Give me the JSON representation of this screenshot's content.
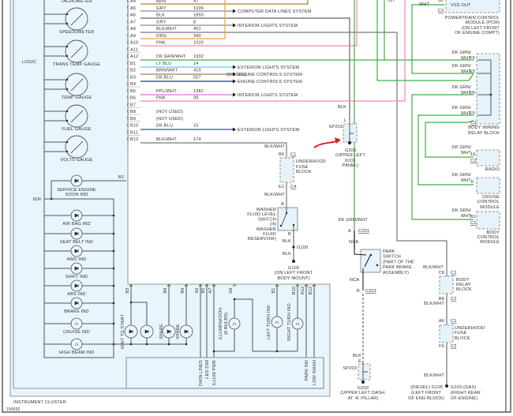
{
  "colors": {
    "cluster_fill": "#e8f5fc",
    "brn": "#a6822e",
    "org": "#f0a040",
    "gry": "#8a8a8a",
    "blk": "#555555",
    "pnk": "#f08aa8",
    "dk_grn_wht": "#3cb043",
    "lt_blu": "#3fe0e8",
    "brn_wht": "#a08050",
    "dk_blu": "#1e3090",
    "ppl_wht": "#e070e0",
    "dk_blu2": "#3a55a8",
    "annotation_red": "#e02020"
  },
  "cluster": {
    "title": "INSTRUMENT CLUSTER",
    "figure_id": "155652",
    "logic_label": "LOGIC",
    "ign_label": "IGN",
    "b2_label": "B2",
    "gauges": [
      "TACHOMETER",
      "SPEEDOMETER",
      "TRANS TEMP GAUGE",
      "TEMP GAUGE",
      "FUEL GAUGE",
      "VOLTS GAUGE"
    ],
    "service_engine": [
      "SERVICE ENGINE",
      "SOON IND"
    ],
    "indicators": [
      "AIR BAG IND",
      "SEAT BELT IND",
      "4WD IND",
      "SHIFT IND",
      "ABS IND",
      "BRAKE IND",
      "CRUISE IND",
      "HIGH BEAM IND"
    ],
    "lower_pins": [
      "B3",
      "B8",
      "B9",
      "A5",
      "B5",
      "A7",
      "A6",
      "B1",
      "B10",
      "A12",
      "B12"
    ],
    "loads": {
      "wait_to_start": "WAIT TO START",
      "spare1": "SPARE",
      "spare2": "SPARE",
      "illumination": "ILLUMINATION",
      "illumination_count": "(6 BULBS)",
      "left_turn": "LEFT TURN IND",
      "right_turn": "RIGHT TURN IND"
    },
    "box_labels": [
      "DATA LINES",
      "LED DIM",
      "ILLUM PWR",
      "PARK SW",
      "LOW WASH"
    ]
  },
  "connector_rows": [
    {
      "pin": "A4",
      "color": "BRN",
      "circuit": "47"
    },
    {
      "pin": "A5",
      "color": "GRY",
      "circuit": "1036"
    },
    {
      "pin": "A6",
      "color": "BLK",
      "circuit": "1850"
    },
    {
      "pin": "A7",
      "color": "GRY",
      "circuit": "8"
    },
    {
      "pin": "A8",
      "color": "BLK/WHT",
      "circuit": "451"
    },
    {
      "pin": "A9",
      "color": "ORG",
      "circuit": "340"
    },
    {
      "pin": "A10",
      "color": "PNK",
      "circuit": "1020"
    },
    {
      "pin": "A11",
      "color": "",
      "circuit": ""
    },
    {
      "pin": "A12",
      "color": "DK GRN/WHT",
      "circuit": "1932"
    },
    {
      "pin": "B1",
      "color": "LT BLU",
      "circuit": "14"
    },
    {
      "pin": "B2",
      "color": "BRN/WHT",
      "circuit": "419"
    },
    {
      "pin": "B3",
      "color": "DK BLU",
      "circuit": "507"
    },
    {
      "pin": "B4",
      "color": "",
      "circuit": ""
    },
    {
      "pin": "B5",
      "color": "PPL/WHT",
      "circuit": "1382"
    },
    {
      "pin": "B6",
      "color": "PNK",
      "circuit": "39"
    },
    {
      "pin": "B7",
      "color": "",
      "circuit": ""
    },
    {
      "pin": "B8",
      "color": "(NOT USED)",
      "circuit": ""
    },
    {
      "pin": "B9",
      "color": "(NOT USED)",
      "circuit": ""
    },
    {
      "pin": "B10",
      "color": "DK BLU",
      "circuit": "15"
    },
    {
      "pin": "B11",
      "color": "",
      "circuit": ""
    },
    {
      "pin": "B12",
      "color": "BLK/WHT",
      "circuit": "174"
    }
  ],
  "diesel_note": "(DIESEL)",
  "systems": {
    "a5": "COMPUTER DATA LINES SYSTEM",
    "a7": "INTERIOR LIGHTS SYSTEM",
    "b1": "EXTERIOR LIGHTS SYSTEM",
    "b2": "ENGINE CONTROLS SYSTEM",
    "b3": "ENGINE CONTROLS SYSTEM",
    "b5": "INTERIOR LIGHTS SYSTEM",
    "b10": "EXTERIOR LIGHTS SYSTEM"
  },
  "pcm": {
    "circuit": "517",
    "wire": "WHT",
    "pin": "50",
    "connector": "C2",
    "signal": "VSS OUT",
    "label": [
      "POWERTRAIN CONTROL",
      "MODULE (PCM)",
      "(ON LEFT FRONT",
      "OF ENGINE COMPT)"
    ]
  },
  "body_wiring_relay_block": {
    "wire_label": [
      "DK GRN/",
      "WHT"
    ],
    "pins": [
      "F6",
      "E5",
      "D5",
      "F5"
    ],
    "connector": "C3",
    "label": [
      "BODY WIRING",
      "RELAY BLOCK"
    ]
  },
  "radio": {
    "wire_label": [
      "DK GRN/",
      "WHT"
    ],
    "pin": "16",
    "connector": "C2",
    "label": "RADIO"
  },
  "cruise": {
    "wire_label": [
      "DK GRN/",
      "WHT"
    ],
    "pin": "K",
    "label": [
      "CRUISE",
      "CONTROL",
      "MODULE"
    ]
  },
  "bcm": {
    "wire_label": [
      "DK GRN/",
      "WHT"
    ],
    "pin": "B1",
    "connector": "C2",
    "label": [
      "BODY",
      "CONTROL",
      "MODULE"
    ]
  },
  "sp203_top": {
    "wire": "BLK",
    "pin": "L",
    "splice": "SP203",
    "ground": "G203",
    "location": [
      "(UPPER LEFT",
      "KICK",
      "PANEL)"
    ]
  },
  "washer_circuit": {
    "wire1": "BLK/WHT",
    "fuse_in_pin": "B6",
    "fuse_in_conn": "C1",
    "fuse_label": [
      "UNDERHOOD",
      "FUSE",
      "BLOCK"
    ],
    "fuse_out_pin": "E2",
    "fuse_out_conn": "C4",
    "wire2": "BLK/WHT",
    "switch_pin_a": "A",
    "switch_label": [
      "WASHER",
      "FLUID LEVEL",
      "SWITCH",
      "(IN",
      "WASHER",
      "FLUID",
      "RESERVOIR)"
    ],
    "switch_pin_b": "B",
    "wire3": "BLK",
    "splice": "G100",
    "wire4": "BLK",
    "ground": "G100",
    "ground_location": [
      "(ON LEFT FRONT",
      "BODY MOUNT)"
    ]
  },
  "park_circuit": {
    "wire": "DK GRN/WHT",
    "pin_a": "A",
    "conn": "C201",
    "nca_top": "NCA",
    "switch_label": [
      "PARK",
      "SWITCH",
      "(PART OF THE",
      "PARK BRAKE",
      "ASSEMBLY)"
    ],
    "nca_bottom": "NCA",
    "pin_b": "B",
    "conn_b": "C201",
    "wire_blk": "BLK",
    "pin_e": "E",
    "splice": "SP203",
    "ground": "G203",
    "ground_location": [
      "(UPPER LEFT DASH,",
      "AT 'A' PILLAR)"
    ]
  },
  "ground_circuit": {
    "wire1": "BLK/WHT",
    "relay_in_pin": "C8",
    "relay_in_conn": "C2",
    "relay_label": [
      "BODY",
      "RELAY",
      "BLOCK"
    ],
    "relay_out_pin": "B8",
    "relay_out_conn": "C2",
    "wire2": "BLK/WHT",
    "fuse_in_pin": "A6",
    "fuse_in_conn": "C1",
    "fuse_label": [
      "UNDERHOOD",
      "FUSE",
      "BLOCK"
    ],
    "fuse_out_pin": "F6",
    "fuse_out_conn": "C2",
    "wire3": "BLK/WHT",
    "diesel_ground": [
      "(DIESEL) G105",
      "(LEFT FRONT",
      "OF ENG BLOCK)"
    ],
    "gas_ground": [
      "G103  (GAS)",
      "(RIGHT REAR",
      "OF ENGINE)"
    ]
  }
}
